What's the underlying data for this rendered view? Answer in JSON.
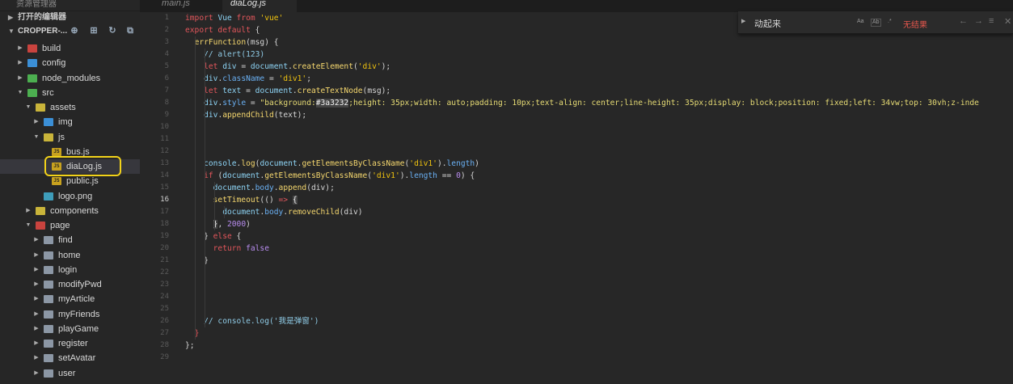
{
  "sidebar": {
    "top_title": "资源管理器",
    "open_editors": "打开的编辑器",
    "project": "CROPPER-...",
    "items": [
      {
        "label": "build",
        "depth": 1,
        "type": "folder",
        "color": "red",
        "arrow": "right"
      },
      {
        "label": "config",
        "depth": 1,
        "type": "folder",
        "color": "blue",
        "arrow": "right"
      },
      {
        "label": "node_modules",
        "depth": 1,
        "type": "folder",
        "color": "green",
        "arrow": "right"
      },
      {
        "label": "src",
        "depth": 1,
        "type": "folder",
        "color": "green",
        "arrow": "down"
      },
      {
        "label": "assets",
        "depth": 2,
        "type": "folder",
        "color": "yellow",
        "arrow": "down"
      },
      {
        "label": "img",
        "depth": 3,
        "type": "folder",
        "color": "blue",
        "arrow": "right"
      },
      {
        "label": "js",
        "depth": 3,
        "type": "folder",
        "color": "yellow",
        "arrow": "down"
      },
      {
        "label": "bus.js",
        "depth": 4,
        "type": "js"
      },
      {
        "label": "diaLog.js",
        "depth": 4,
        "type": "js",
        "selected": true
      },
      {
        "label": "public.js",
        "depth": 4,
        "type": "js"
      },
      {
        "label": "logo.png",
        "depth": 3,
        "type": "img"
      },
      {
        "label": "components",
        "depth": 2,
        "type": "folder",
        "color": "yellow",
        "arrow": "right"
      },
      {
        "label": "page",
        "depth": 2,
        "type": "folder",
        "color": "red",
        "arrow": "down"
      },
      {
        "label": "find",
        "depth": 3,
        "type": "folder",
        "color": "gray",
        "arrow": "right"
      },
      {
        "label": "home",
        "depth": 3,
        "type": "folder",
        "color": "gray",
        "arrow": "right"
      },
      {
        "label": "login",
        "depth": 3,
        "type": "folder",
        "color": "gray",
        "arrow": "right"
      },
      {
        "label": "modifyPwd",
        "depth": 3,
        "type": "folder",
        "color": "gray",
        "arrow": "right"
      },
      {
        "label": "myArticle",
        "depth": 3,
        "type": "folder",
        "color": "gray",
        "arrow": "right"
      },
      {
        "label": "myFriends",
        "depth": 3,
        "type": "folder",
        "color": "gray",
        "arrow": "right"
      },
      {
        "label": "playGame",
        "depth": 3,
        "type": "folder",
        "color": "gray",
        "arrow": "right"
      },
      {
        "label": "register",
        "depth": 3,
        "type": "folder",
        "color": "gray",
        "arrow": "right"
      },
      {
        "label": "setAvatar",
        "depth": 3,
        "type": "folder",
        "color": "gray",
        "arrow": "right"
      },
      {
        "label": "user",
        "depth": 3,
        "type": "folder",
        "color": "gray",
        "arrow": "right"
      }
    ]
  },
  "tabs": [
    {
      "label": "main.js",
      "active": false
    },
    {
      "label": "diaLog.js",
      "active": true
    }
  ],
  "find": {
    "query": "动起来",
    "no_results": "无结果",
    "opt_case": "Aa",
    "opt_word": "Ab",
    "opt_regex": ".*"
  },
  "current_line": 16,
  "code": [
    [
      [
        "k",
        "import "
      ],
      [
        "fn",
        "Vue "
      ],
      [
        "k",
        "from "
      ],
      [
        "s",
        "'vue'"
      ]
    ],
    [
      [
        "k",
        "export default "
      ],
      [
        "p",
        "{"
      ]
    ],
    [
      [
        "p",
        "  "
      ],
      [
        "mth",
        "errFunction"
      ],
      [
        "p",
        "(msg) {"
      ]
    ],
    [
      [
        "p",
        "    "
      ],
      [
        "c",
        "// alert(123)"
      ]
    ],
    [
      [
        "p",
        "    "
      ],
      [
        "k",
        "let "
      ],
      [
        "fn",
        "div "
      ],
      [
        "p",
        "= "
      ],
      [
        "fn",
        "document"
      ],
      [
        "p",
        "."
      ],
      [
        "mth",
        "createElement"
      ],
      [
        "p",
        "("
      ],
      [
        "s",
        "'div'"
      ],
      [
        "p",
        ");"
      ]
    ],
    [
      [
        "p",
        "    "
      ],
      [
        "fn",
        "div"
      ],
      [
        "p",
        "."
      ],
      [
        "pr",
        "className"
      ],
      [
        "p",
        " = "
      ],
      [
        "s",
        "'div1'"
      ],
      [
        "p",
        ";"
      ]
    ],
    [
      [
        "p",
        "    "
      ],
      [
        "k",
        "let "
      ],
      [
        "fn",
        "text "
      ],
      [
        "p",
        "= "
      ],
      [
        "fn",
        "document"
      ],
      [
        "p",
        "."
      ],
      [
        "mth",
        "createTextNode"
      ],
      [
        "p",
        "(msg);"
      ]
    ],
    [
      [
        "p",
        "    "
      ],
      [
        "fn",
        "div"
      ],
      [
        "p",
        "."
      ],
      [
        "pr",
        "style"
      ],
      [
        "p",
        " = "
      ],
      [
        "sv",
        "\"background:"
      ],
      [
        "sel",
        "#3a3232"
      ],
      [
        "sv",
        ";height: 35px;width: auto;padding: 10px;text-align: center;line-height: 35px;display: block;position: fixed;left: 34vw;top: 30vh;z-inde"
      ]
    ],
    [
      [
        "p",
        "    "
      ],
      [
        "fn",
        "div"
      ],
      [
        "p",
        "."
      ],
      [
        "mth",
        "appendChild"
      ],
      [
        "p",
        "(text);"
      ]
    ],
    [],
    [],
    [],
    [
      [
        "p",
        "    "
      ],
      [
        "fn",
        "console"
      ],
      [
        "p",
        "."
      ],
      [
        "mth",
        "log"
      ],
      [
        "p",
        "("
      ],
      [
        "fn",
        "document"
      ],
      [
        "p",
        "."
      ],
      [
        "mth",
        "getElementsByClassName"
      ],
      [
        "p",
        "("
      ],
      [
        "s",
        "'div1'"
      ],
      [
        "p",
        ")."
      ],
      [
        "pr",
        "length"
      ],
      [
        "p",
        ")"
      ]
    ],
    [
      [
        "p",
        "    "
      ],
      [
        "k",
        "if "
      ],
      [
        "p",
        "("
      ],
      [
        "fn",
        "document"
      ],
      [
        "p",
        "."
      ],
      [
        "mth",
        "getElementsByClassName"
      ],
      [
        "p",
        "("
      ],
      [
        "s",
        "'div1'"
      ],
      [
        "p",
        ")."
      ],
      [
        "pr",
        "length"
      ],
      [
        "p",
        " == "
      ],
      [
        "n",
        "0"
      ],
      [
        "p",
        ") {"
      ]
    ],
    [
      [
        "p",
        "      "
      ],
      [
        "fn",
        "document"
      ],
      [
        "p",
        "."
      ],
      [
        "pr",
        "body"
      ],
      [
        "p",
        "."
      ],
      [
        "mth",
        "append"
      ],
      [
        "p",
        "(div);"
      ]
    ],
    [
      [
        "p",
        "      "
      ],
      [
        "mth",
        "setTimeout"
      ],
      [
        "p",
        "(() "
      ],
      [
        "k",
        "=> "
      ],
      [
        "sel",
        "{"
      ]
    ],
    [
      [
        "p",
        "        "
      ],
      [
        "fn",
        "document"
      ],
      [
        "p",
        "."
      ],
      [
        "pr",
        "body"
      ],
      [
        "p",
        "."
      ],
      [
        "mth",
        "removeChild"
      ],
      [
        "p",
        "(div)"
      ]
    ],
    [
      [
        "p",
        "      "
      ],
      [
        "sel",
        "}"
      ],
      [
        "p",
        ", "
      ],
      [
        "n",
        "2000"
      ],
      [
        "p",
        ")"
      ]
    ],
    [
      [
        "p",
        "    } "
      ],
      [
        "k",
        "else "
      ],
      [
        "p",
        "{"
      ]
    ],
    [
      [
        "p",
        "      "
      ],
      [
        "k",
        "return "
      ],
      [
        "n",
        "false"
      ]
    ],
    [
      [
        "p",
        "    }"
      ]
    ],
    [],
    [],
    [],
    [],
    [
      [
        "p",
        "    "
      ],
      [
        "c",
        "// console.log('我是弹窗')"
      ]
    ],
    [
      [
        "p",
        "  "
      ],
      [
        "k",
        "}"
      ]
    ],
    [
      [
        "p",
        "};"
      ]
    ],
    []
  ]
}
